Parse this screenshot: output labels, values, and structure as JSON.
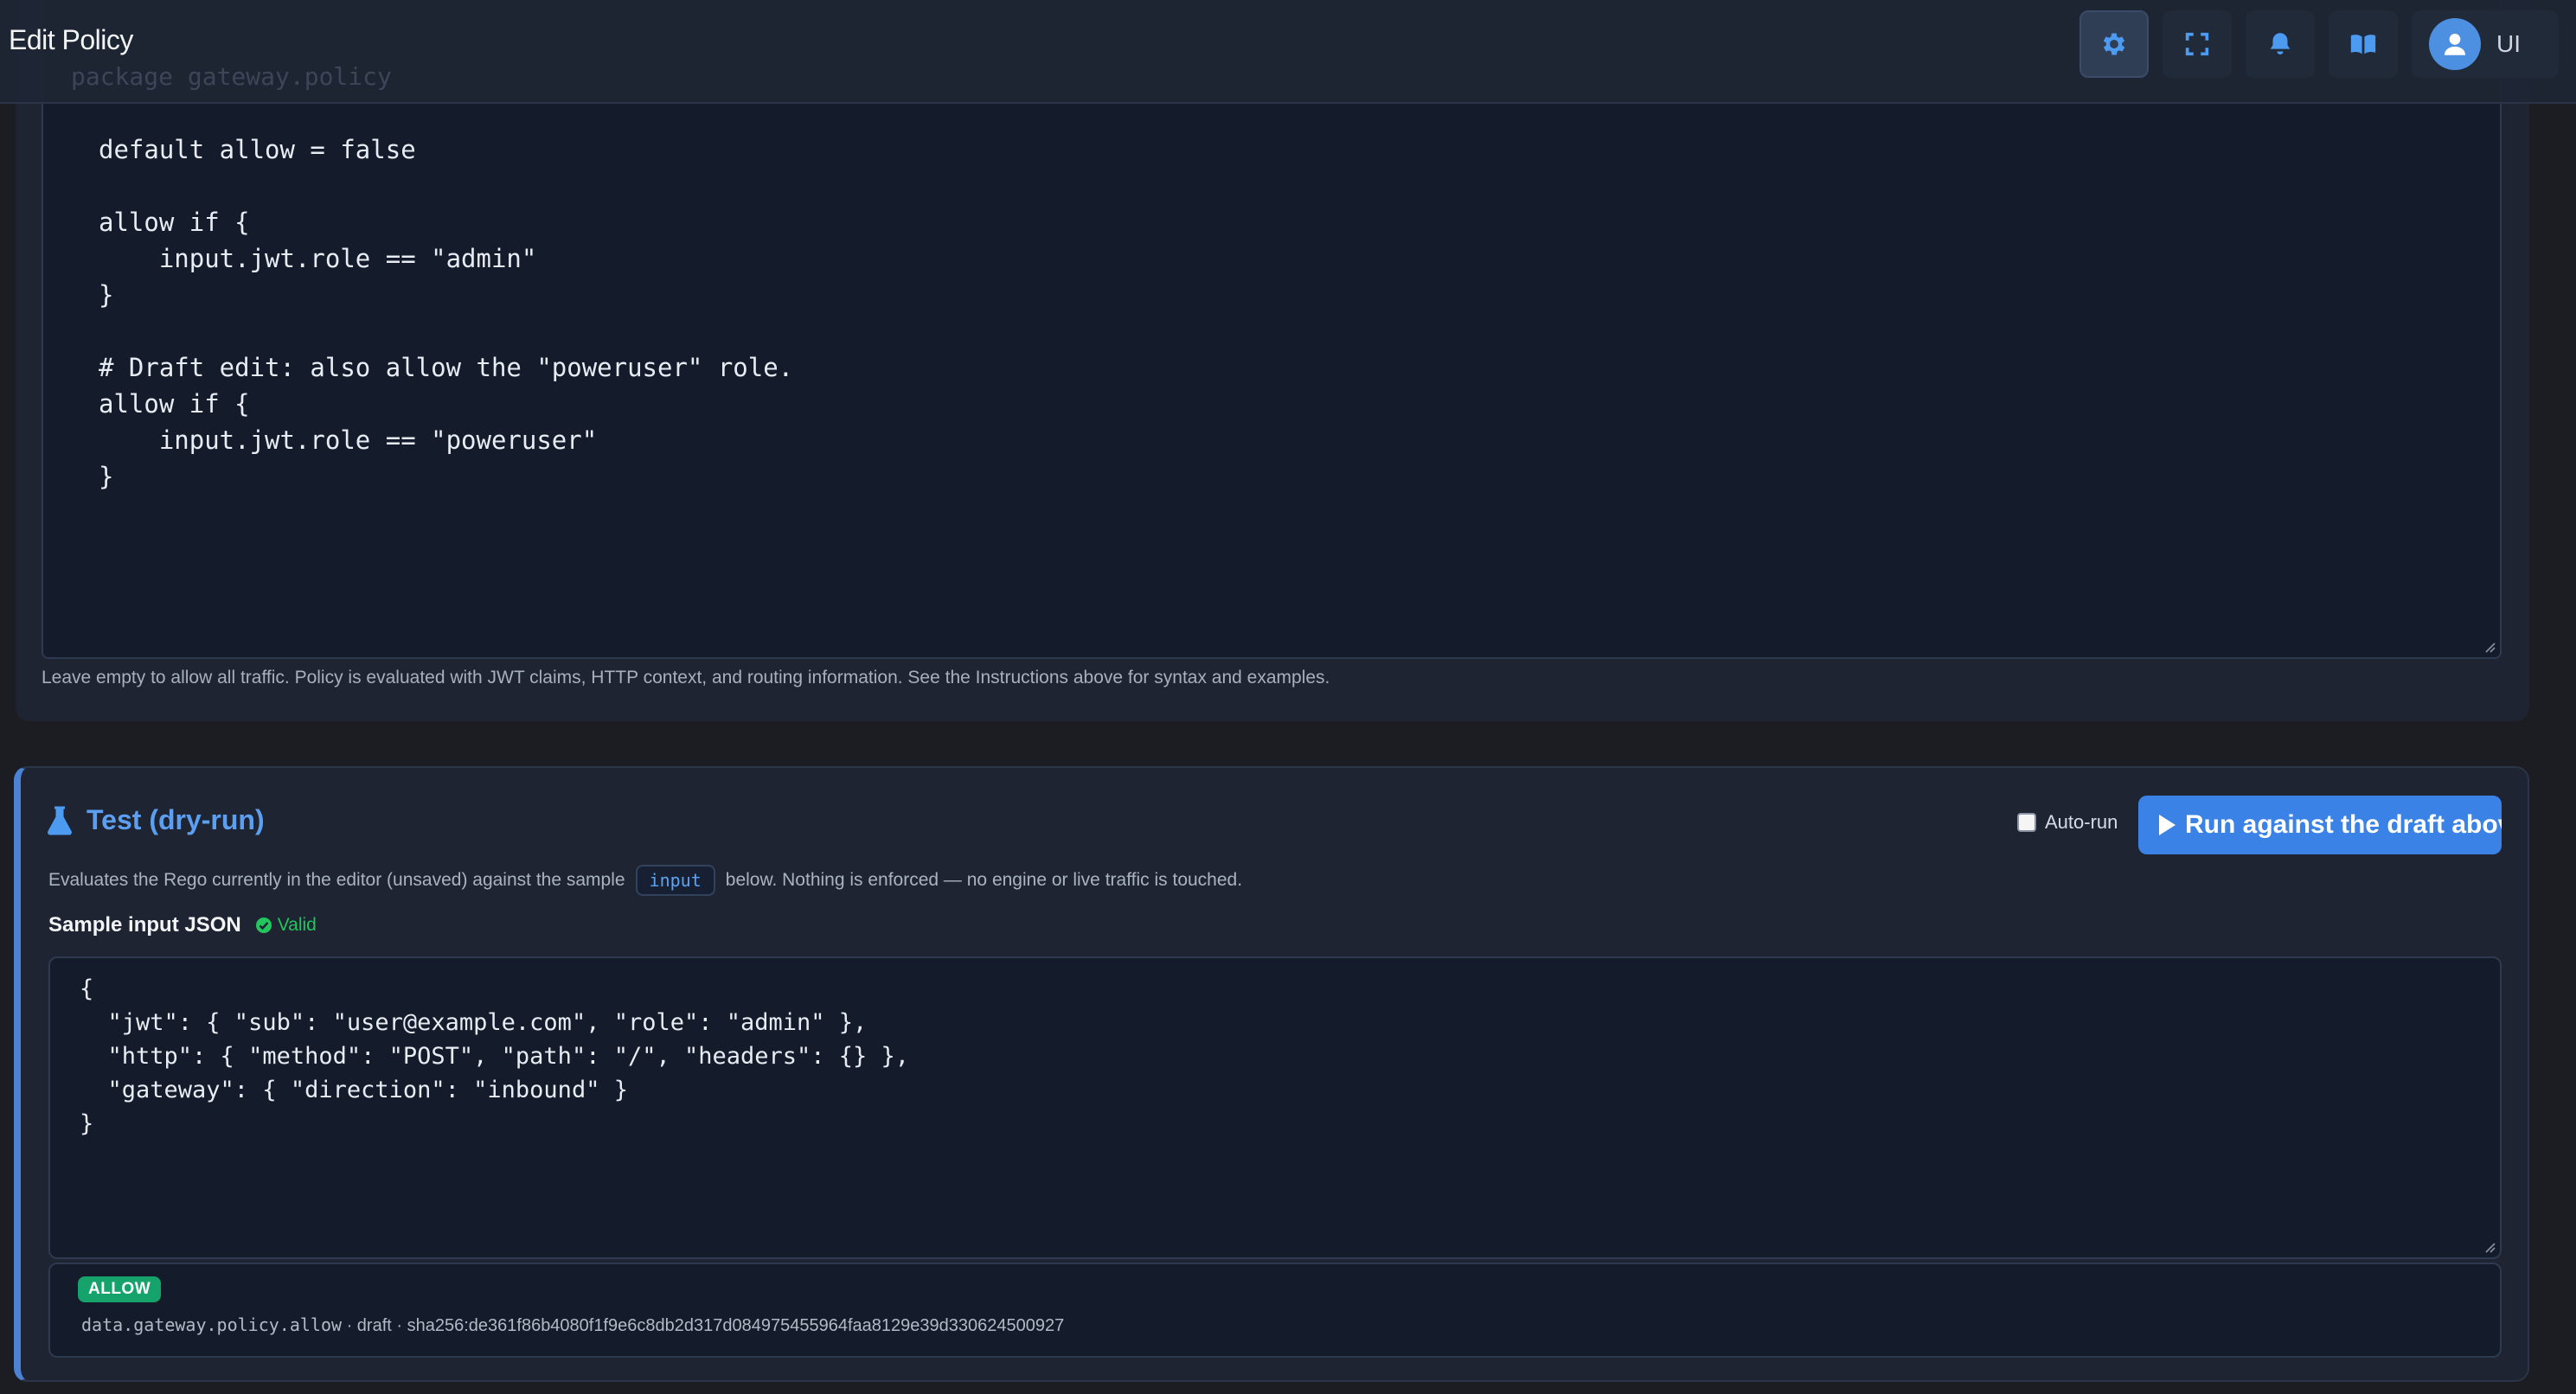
{
  "header": {
    "title": "Edit Policy",
    "ghost_text": "package gateway.policy",
    "buttons": [
      {
        "name": "settings",
        "icon": "gear-icon"
      },
      {
        "name": "fullscreen",
        "icon": "expand-icon"
      },
      {
        "name": "notifications",
        "icon": "bell-icon"
      },
      {
        "name": "docs",
        "icon": "book-open-icon"
      }
    ],
    "user": {
      "initials": "UI",
      "icon": "user-avatar-icon"
    }
  },
  "policy_editor": {
    "lines": [
      "default allow = false",
      "",
      "allow if {",
      "    input.jwt.role == \"admin\"",
      "}",
      "",
      "# Draft edit: also allow the \"poweruser\" role.",
      "allow if {",
      "    input.jwt.role == \"poweruser\"",
      "}"
    ],
    "hint": "Leave empty to allow all traffic. Policy is evaluated with JWT claims, HTTP context, and routing information. See the Instructions above for syntax and examples."
  },
  "test_panel": {
    "title": "Test (dry-run)",
    "icon": "flask-icon",
    "autorun_label": "Auto-run",
    "autorun_checked": false,
    "run_button_label": "Run against the draft above",
    "description_before": "Evaluates the Rego currently in the editor (unsaved) against the sample",
    "description_chip": "input",
    "description_after": "below. Nothing is enforced — no engine or live traffic is touched.",
    "sample_label": "Sample input JSON",
    "valid_label": "Valid",
    "sample_json_lines": [
      "{",
      "  \"jwt\": { \"sub\": \"user@example.com\", \"role\": \"admin\" },",
      "  \"http\": { \"method\": \"POST\", \"path\": \"/\", \"headers\": {} },",
      "  \"gateway\": { \"direction\": \"inbound\" }",
      "}"
    ],
    "result": {
      "badge": "ALLOW",
      "query": "data.gateway.policy.allow",
      "meta": " · draft · sha256:de361f86b4080f1f9e6c8db2d317d084975455964faa8129e39d330624500927"
    }
  },
  "colors": {
    "accent": "#3b82e6",
    "title_blue": "#5c9ff0",
    "allow_green": "#15a36b",
    "valid_green": "#22c55e",
    "panel_bg": "#1e2432",
    "editor_bg": "#141b2a"
  }
}
